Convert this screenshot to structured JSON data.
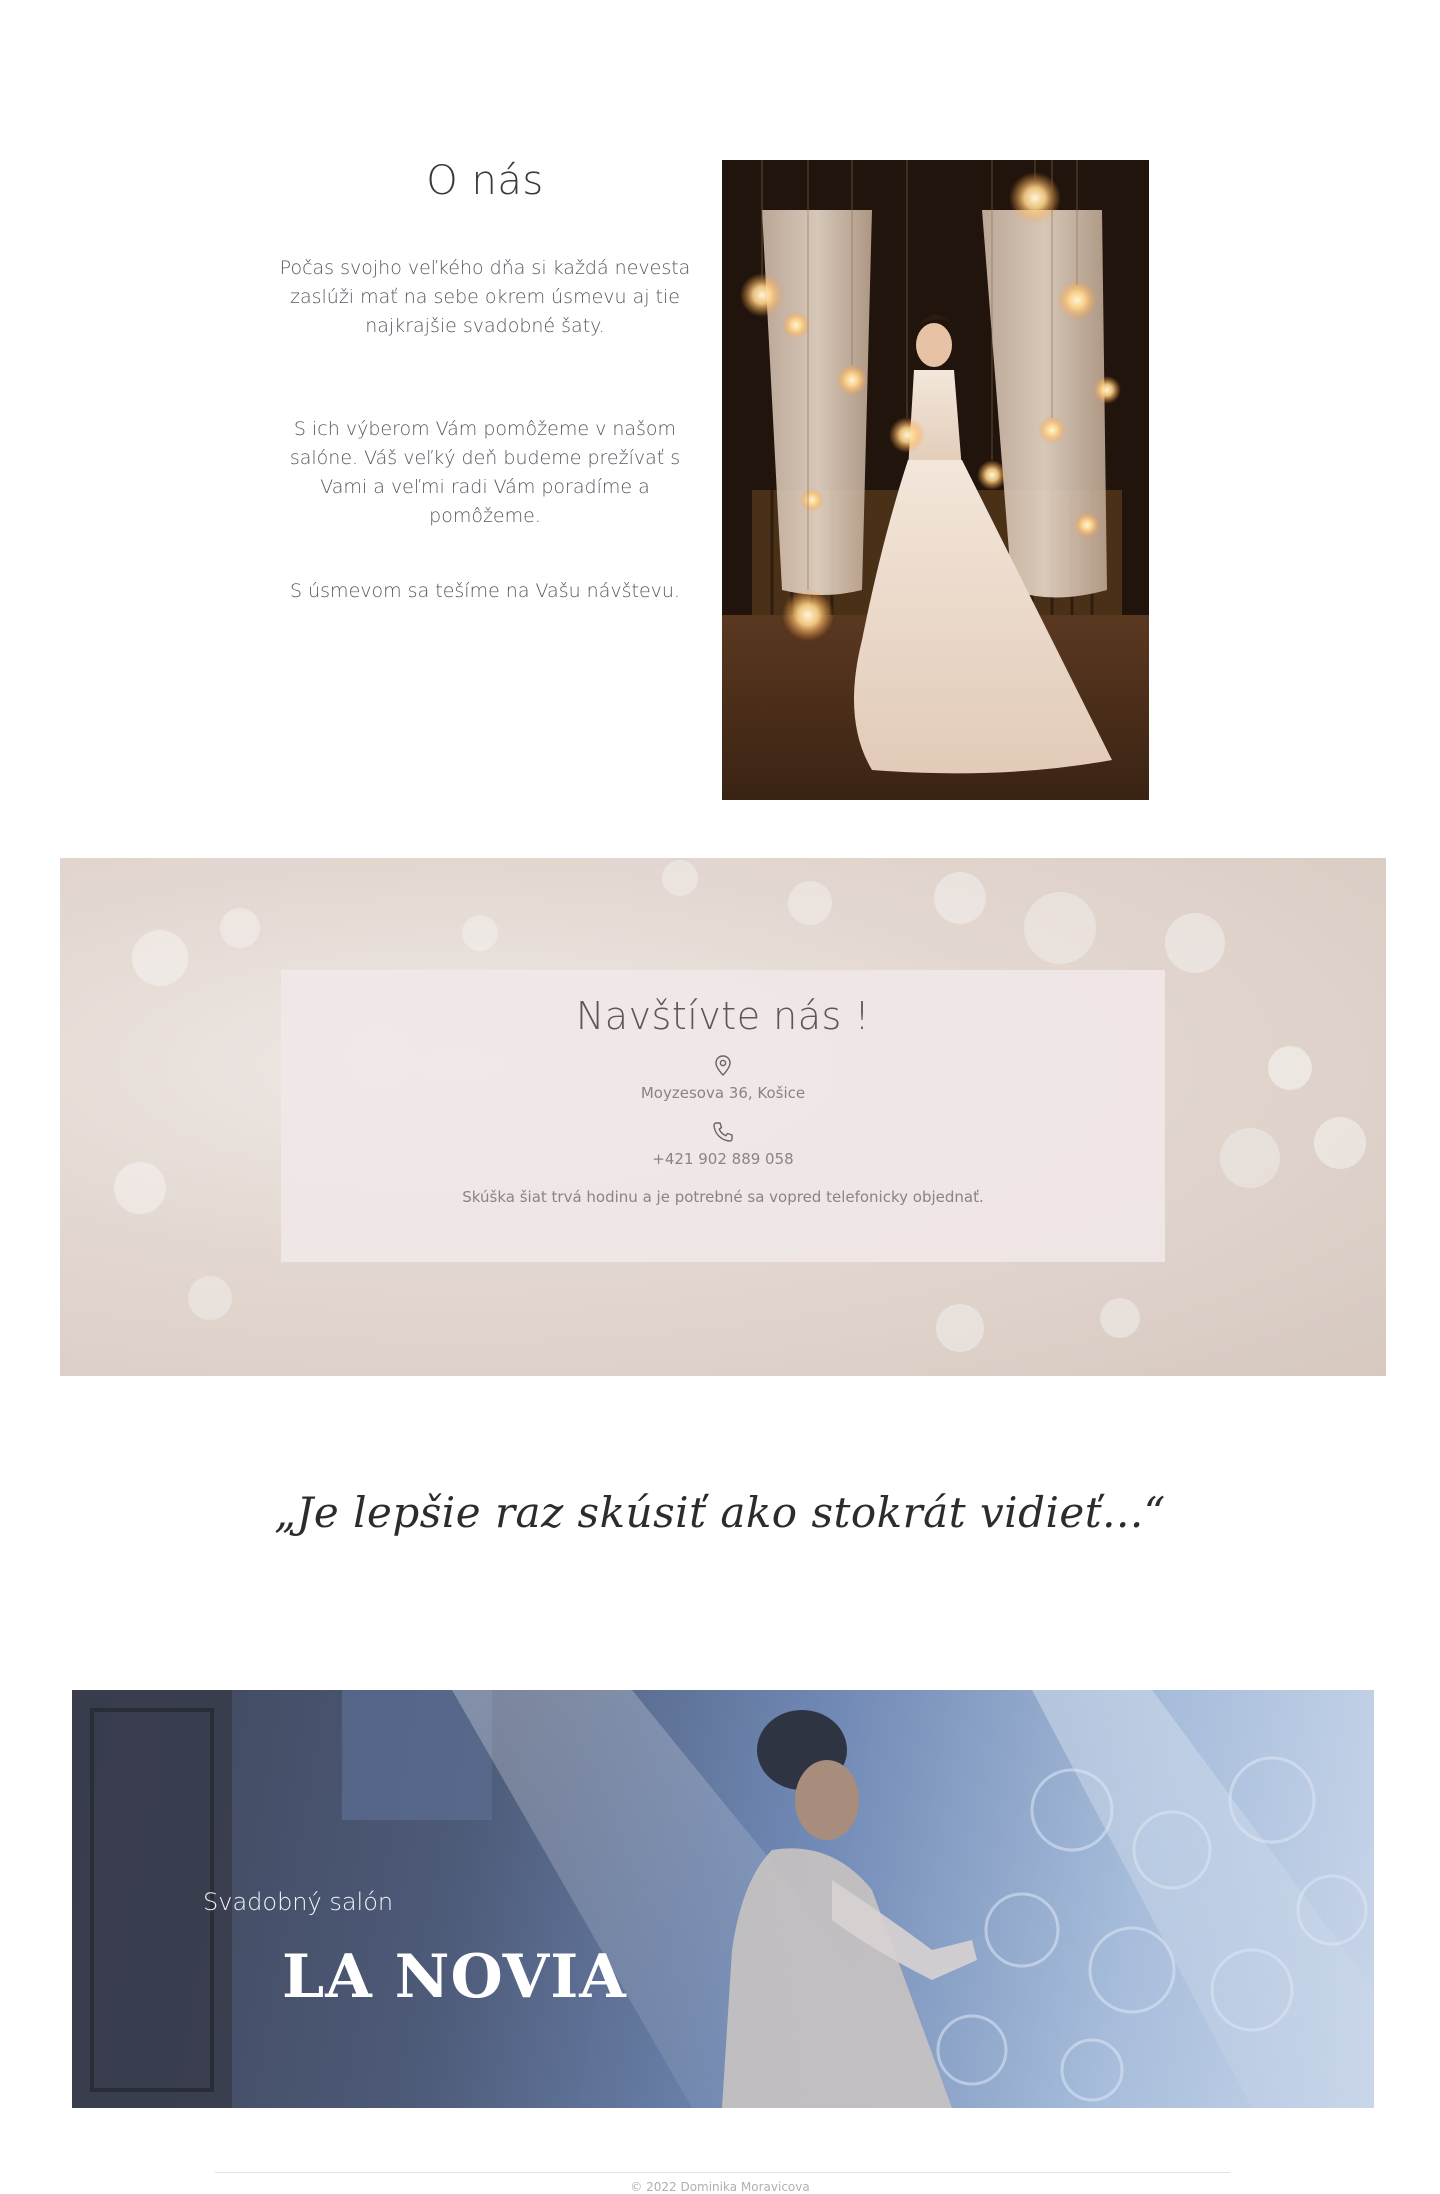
{
  "about": {
    "title": "O nás",
    "paragraph_1": "Počas svojho veľkého dňa si každá nevesta zaslúži mať na sebe okrem úsmevu aj tie najkrajšie svadobné šaty.",
    "paragraph_2": "S ich výberom Vám pomôžeme v našom salóne. Váš veľký deň budeme prežívať s Vami a veľmi radi Vám poradíme a pomôžeme.",
    "paragraph_3": "S úsmevom sa tešíme na Vašu návštevu.",
    "photo_icon": "bride-photo"
  },
  "visit": {
    "title": "Navštívte nás !",
    "address_icon": "location-pin-icon",
    "address": "Moyzesova 36, Košice",
    "phone_icon": "phone-icon",
    "phone": "+421 902 889 058",
    "note": "Skúška šiat trvá hodinu a je potrebné sa vopred telefonicky objednať."
  },
  "quote": {
    "text": "„Je lepšie raz skúsiť ako stokrát vidieť...“"
  },
  "banner": {
    "subtitle": "Svadobný salón",
    "title": "LA NOVIA"
  },
  "footer": {
    "copyright": "© 2022 Dominika Moravicova"
  },
  "colors": {
    "text": "#5b5560",
    "heading": "#3a3a3a",
    "card": "#f0e8e8",
    "banner_text": "#ffffff"
  }
}
